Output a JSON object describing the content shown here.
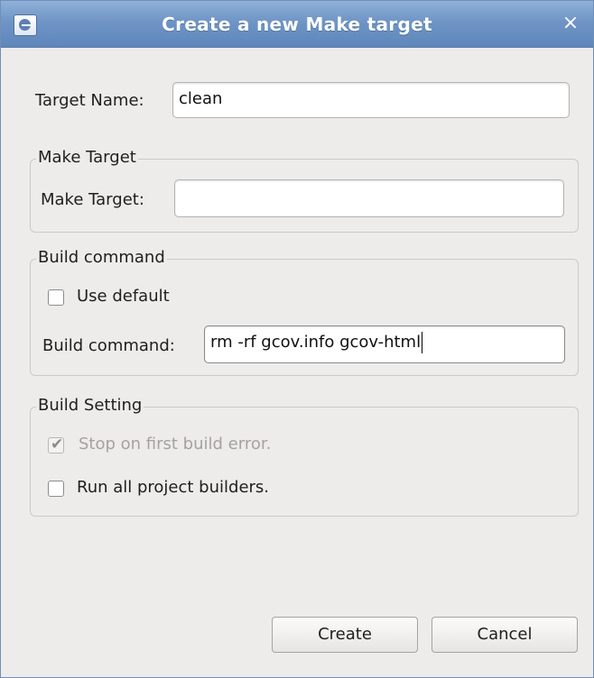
{
  "window": {
    "title": "Create a new Make target",
    "close_glyph": "×"
  },
  "target_name": {
    "label": "Target Name:",
    "value": "clean"
  },
  "make_target_group": {
    "title": "Make Target",
    "label": "Make Target:",
    "value": ""
  },
  "build_command_group": {
    "title": "Build command",
    "use_default_label": "Use default",
    "use_default_checked": false,
    "command_label": "Build command:",
    "command_value": "rm -rf gcov.info gcov-html"
  },
  "build_setting_group": {
    "title": "Build Setting",
    "stop_on_error_label": "Stop on first build error.",
    "stop_on_error_checked": true,
    "stop_on_error_enabled": false,
    "run_all_builders_label": "Run all project builders.",
    "run_all_builders_checked": false,
    "checkmark_glyph": "✔"
  },
  "buttons": {
    "create": "Create",
    "cancel": "Cancel"
  }
}
